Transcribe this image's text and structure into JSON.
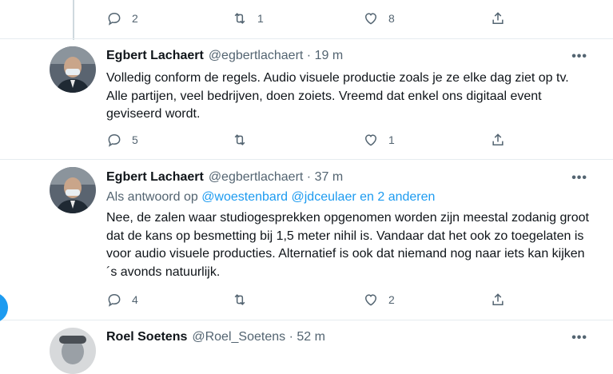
{
  "top_actions": {
    "reply_count": "2",
    "retweet_count": "1",
    "like_count": "8"
  },
  "tweets": [
    {
      "name": "Egbert Lachaert",
      "handle": "@egbertlachaert",
      "sep": "·",
      "time": "19 m",
      "more": "•••",
      "text": "Volledig conform de regels. Audio visuele productie zoals je ze elke dag ziet op tv. Alle partijen, veel bedrijven, doen zoiets. Vreemd dat enkel ons digitaal event geviseerd wordt.",
      "reply_count": "5",
      "retweet_count": "",
      "like_count": "1"
    },
    {
      "name": "Egbert Lachaert",
      "handle": "@egbertlachaert",
      "sep": "·",
      "time": "37 m",
      "more": "•••",
      "reply_prefix": "Als antwoord op",
      "reply_user1": "@woestenbard",
      "reply_user2": "@jdceulaer",
      "reply_suffix": "en 2 anderen",
      "text": "Nee, de zalen waar studiogesprekken opgenomen worden zijn meestal zodanig groot dat de kans op besmetting bij 1,5 meter nihil is. Vandaar dat het ook zo toegelaten is voor audio visuele producties. Alternatief is ook dat niemand nog naar iets kan kijken ´s avonds natuurlijk.",
      "reply_count": "4",
      "retweet_count": "",
      "like_count": "2"
    },
    {
      "name": "Roel Soetens",
      "handle": "@Roel_Soetens",
      "sep": "·",
      "time": "52 m",
      "more": "•••"
    }
  ],
  "colors": {
    "link": "#1d9bf0",
    "muted": "#536471",
    "divider": "#e6ecf0"
  }
}
